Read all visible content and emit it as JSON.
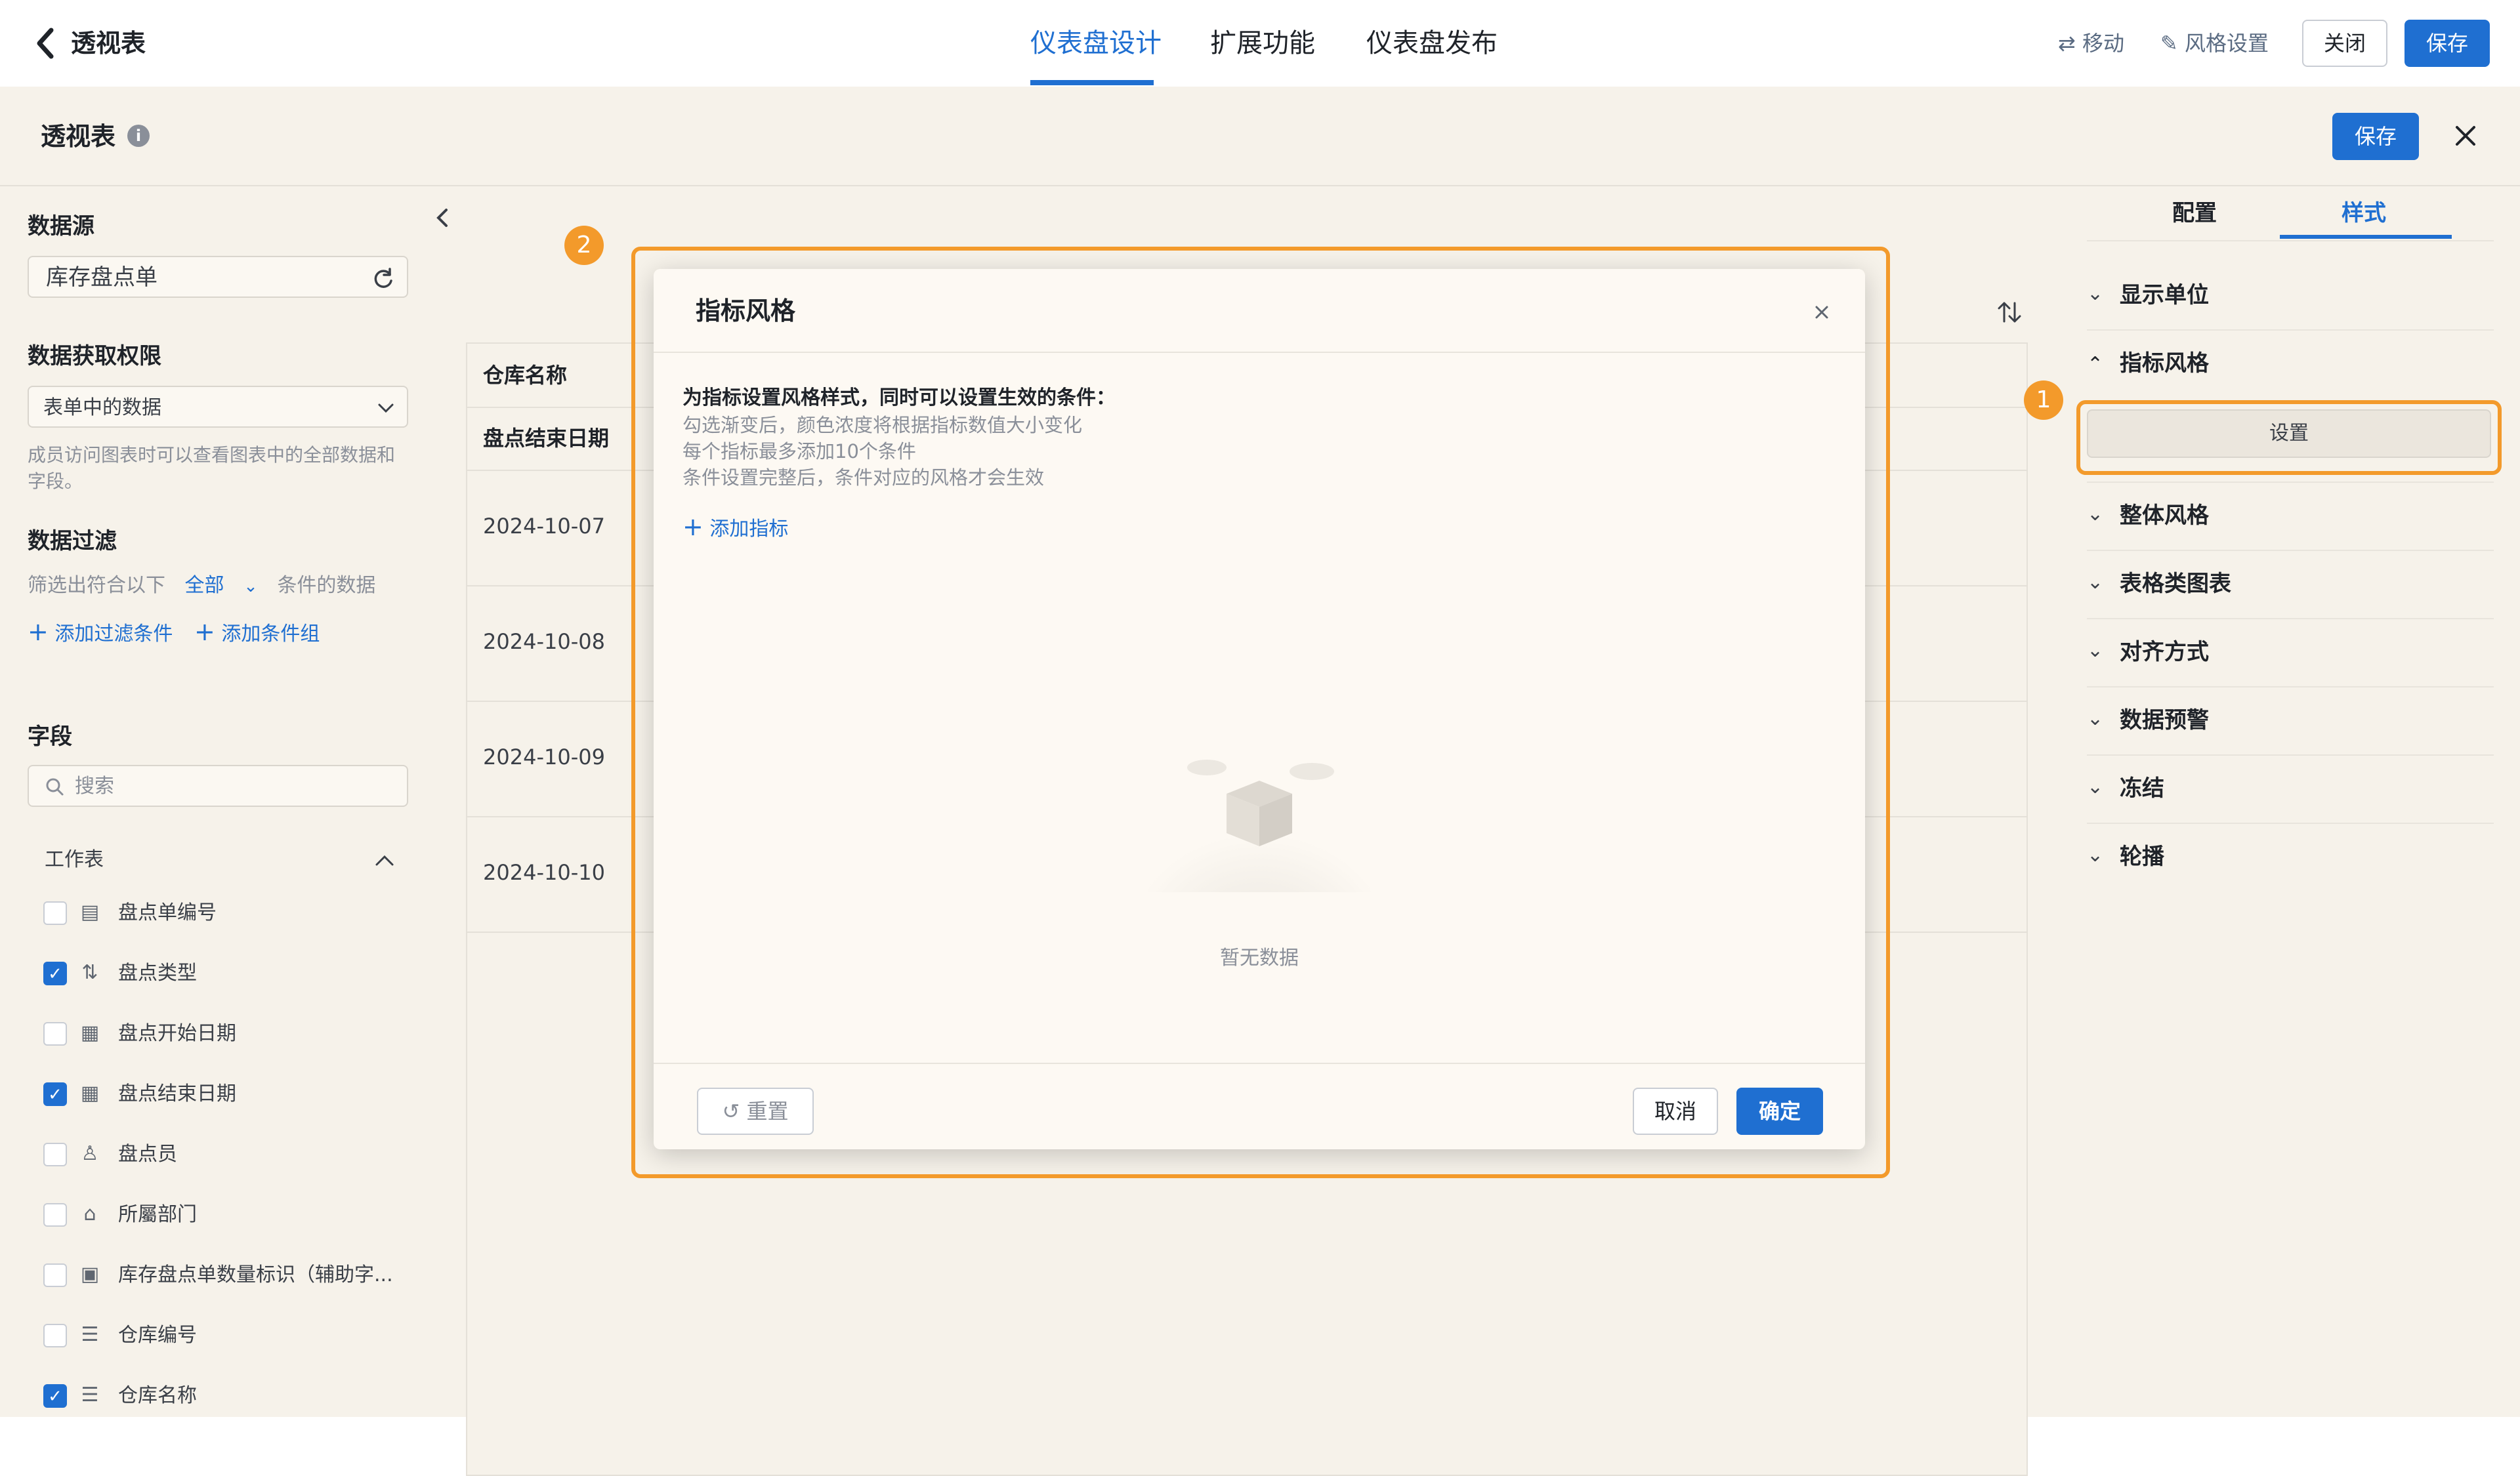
{
  "topbar": {
    "back_icon": "chevron-left-icon",
    "title": "透视表",
    "tabs": [
      {
        "label": "仪表盘设计",
        "active": true
      },
      {
        "label": "扩展功能",
        "active": false
      },
      {
        "label": "仪表盘发布",
        "active": false
      }
    ],
    "move_label": "移动",
    "style_settings_label": "风格设置",
    "close_label": "关闭",
    "save_label": "保存"
  },
  "drawer": {
    "title": "透视表",
    "info_icon": "info-icon",
    "save_label": "保存",
    "close_icon": "close-icon"
  },
  "left": {
    "datasource_title": "数据源",
    "datasource_value": "库存盘点单",
    "permission_title": "数据获取权限",
    "permission_value": "表单中的数据",
    "permission_help": "成员访问图表时可以查看图表中的全部数据和字段。",
    "filter_title": "数据过滤",
    "filter_prefix": "筛选出符合以下",
    "filter_scope": "全部",
    "filter_suffix": "条件的数据",
    "add_filter_label": "添加过滤条件",
    "add_group_label": "添加条件组",
    "fields_title": "字段",
    "search_placeholder": "搜索",
    "group_label": "工作表",
    "fields": [
      {
        "label": "盘点单编号",
        "checked": false,
        "icon": "serial-number-icon"
      },
      {
        "label": "盘点类型",
        "checked": true,
        "icon": "sort-list-icon"
      },
      {
        "label": "盘点开始日期",
        "checked": false,
        "icon": "calendar-icon"
      },
      {
        "label": "盘点结束日期",
        "checked": true,
        "icon": "calendar-icon"
      },
      {
        "label": "盘点员",
        "checked": false,
        "icon": "user-icon"
      },
      {
        "label": "所屬部门",
        "checked": false,
        "icon": "department-icon"
      },
      {
        "label": "库存盘点单数量标识（辅助字...",
        "checked": false,
        "icon": "number-icon"
      },
      {
        "label": "仓库编号",
        "checked": false,
        "icon": "text-lines-icon"
      },
      {
        "label": "仓库名称",
        "checked": true,
        "icon": "text-lines-icon"
      }
    ]
  },
  "table": {
    "header1": "仓库名称",
    "header2": "盘点结束日期",
    "rows": [
      "2024-10-07",
      "2024-10-08",
      "2024-10-09",
      "2024-10-10"
    ]
  },
  "right": {
    "tabs": [
      {
        "label": "配置",
        "active": false
      },
      {
        "label": "样式",
        "active": true
      }
    ],
    "sections": [
      {
        "label": "显示单位",
        "expanded": false
      },
      {
        "label": "指标风格",
        "expanded": true
      },
      {
        "label": "整体风格",
        "expanded": false
      },
      {
        "label": "表格类图表",
        "expanded": false
      },
      {
        "label": "对齐方式",
        "expanded": false
      },
      {
        "label": "数据预警",
        "expanded": false
      },
      {
        "label": "冻结",
        "expanded": false
      },
      {
        "label": "轮播",
        "expanded": false
      }
    ],
    "settings_button_label": "设置"
  },
  "modal": {
    "title": "指标风格",
    "intro": "为指标设置风格样式，同时可以设置生效的条件：",
    "notes": [
      "勾选渐变后，颜色浓度将根据指标数值大小变化",
      "每个指标最多添加10个条件",
      "条件设置完整后，条件对应的风格才会生效"
    ],
    "add_metric_label": "添加指标",
    "empty_text": "暂无数据",
    "reset_label": "重置",
    "cancel_label": "取消",
    "confirm_label": "确定"
  },
  "annotations": {
    "badge1": "1",
    "badge2": "2",
    "color": "#f39a2b"
  },
  "colors": {
    "primary": "#1f6fd1",
    "highlight": "#f39a2b",
    "drawer_bg": "#f6f2ea"
  }
}
